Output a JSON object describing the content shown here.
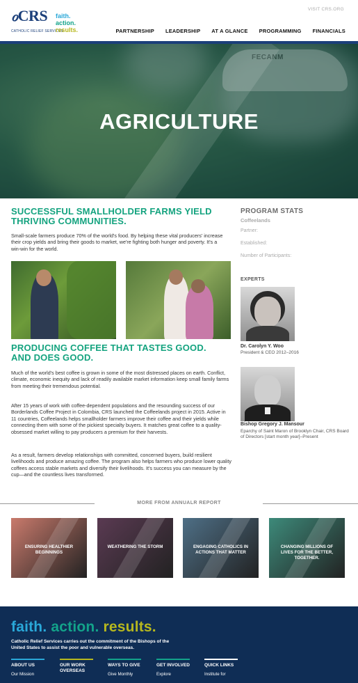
{
  "header": {
    "logo_main": "CRS",
    "logo_sub": "CATHOLIC RELIEF SERVICES",
    "tagline": [
      "faith.",
      "action.",
      "results."
    ],
    "visit_link": "VISIT CRS.ORG",
    "nav": [
      "PARTNERSHIP",
      "LEADERSHIP",
      "AT A GLANCE",
      "PROGRAMMING",
      "FINANCIALS"
    ]
  },
  "hero": {
    "title": "AGRICULTURE",
    "cap_text": "FECANM"
  },
  "main": {
    "heading1": "SUCCESSFUL SMALLHOLDER FARMS YIELD THRIVING COMMUNITIES.",
    "intro": "Small-scale farmers produce 70% of the world's food. By helping these vital producers' increase their crop yields and bring their goods to market, we're fighting both hunger and poverty. It's a win-win for the world.",
    "heading2": "PRODUCING COFFEE THAT TASTES GOOD. AND DOES GOOD.",
    "para1": "Much of the world's best coffee is grown in some of the most distressed places on earth. Conflict, climate, economic inequity and lack of readily available market information keep small family farms from meeting their tremendous potential.",
    "para2": "After 15 years of work with coffee-dependent populations and the resounding success of our Borderlands Coffee Project in Colombia, CRS launched the Coffeelands project in 2015. Active in 11 countries, Coffeelands helps smallholder farmers improve their coffee and their yields while connecting them with some of the pickiest specialty buyers. It matches great coffee to a quality-obsessed market willing to pay producers a premium for their harvests.",
    "para3": "As a result, farmers develop relationships with committed, concerned buyers, build resilient  livelihoods and produce amazing coffee. The program also helps farmers who produce lower quality coffees access stable markets and diversify their livelihoods. It's success you can measure by the cup—and the countless lives transformed."
  },
  "sidebar": {
    "stats_title": "PROGRAM STATS",
    "stats_sub": "Coffeelands",
    "labels": [
      "Partner:",
      "Established:",
      "Number of Participants:"
    ],
    "experts_title": "EXPERTS",
    "experts": [
      {
        "name": "Dr. Carolyn Y. Woo",
        "role": "President & CEO 2012–2016"
      },
      {
        "name": "Bishop Gregory J. Mansour",
        "role": "Eparchy of Saint Maron of Brooklyn Chair, CRS Board of Directors [start month year]–Present"
      }
    ]
  },
  "more": {
    "label": "MORE FROM ANNUALR REPORT",
    "tiles": [
      {
        "text": "ENSURING HEALTHIER BEGINNINGS",
        "color": "#c97a6c"
      },
      {
        "text": "WEATHERING THE STORM",
        "color": "#5a3a52"
      },
      {
        "text": "ENGAGING CATHOLICS IN ACTIONS THAT MATTER",
        "color": "#4e6f86"
      },
      {
        "text": "CHANGING MILLIONS OF LIVES FOR THE BETTER, TOGETHER.",
        "color": "#3d8a7a"
      }
    ]
  },
  "footer": {
    "brand": [
      "faith.",
      "action.",
      "results."
    ],
    "description": "Catholic Relief Services carries out the commitment of the Bishops of the United States to assist the poor and vulnerable overseas.",
    "columns": [
      {
        "head": "ABOUT US",
        "item": "Our Mission",
        "color": "#2aa8d8"
      },
      {
        "head": "OUR WORK OVERSEAS",
        "item": "",
        "color": "#b7b81e"
      },
      {
        "head": "WAYS TO GIVE",
        "item": "Give Monthly",
        "color": "#13a38a"
      },
      {
        "head": "GET INVOLVED",
        "item": "Explore",
        "color": "#13a38a"
      },
      {
        "head": "QUICK LINKS",
        "item": "Institute for",
        "color": "#ffffff"
      }
    ]
  }
}
